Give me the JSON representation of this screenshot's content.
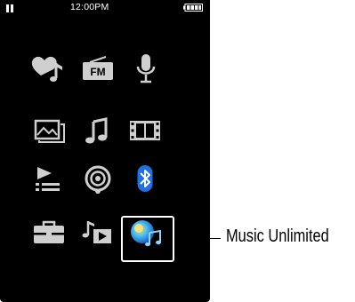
{
  "status_bar": {
    "time": "12:00PM",
    "playback_state_icon": "pause-icon",
    "battery_icon": "battery-full-icon"
  },
  "home_menu": {
    "items": [
      {
        "icon": "favorites-icon"
      },
      {
        "icon": "fm-radio-icon",
        "label": "FM"
      },
      {
        "icon": "microphone-icon"
      },
      {
        "icon": "photo-icon"
      },
      {
        "icon": "music-note-icon"
      },
      {
        "icon": "video-film-icon"
      },
      {
        "icon": "playlist-icon"
      },
      {
        "icon": "podcast-icon"
      },
      {
        "icon": "bluetooth-icon"
      },
      {
        "icon": "toolbox-icon"
      },
      {
        "icon": "now-playing-icon"
      },
      {
        "icon": "music-unlimited-icon"
      }
    ],
    "selected_item": "music-unlimited-icon"
  },
  "callout": {
    "label": "Music Unlimited"
  },
  "colors": {
    "background": "#000000",
    "icon": "#cfcfcf",
    "bluetooth_accent": "#1f6fe6",
    "highlight": "#ffffff"
  }
}
